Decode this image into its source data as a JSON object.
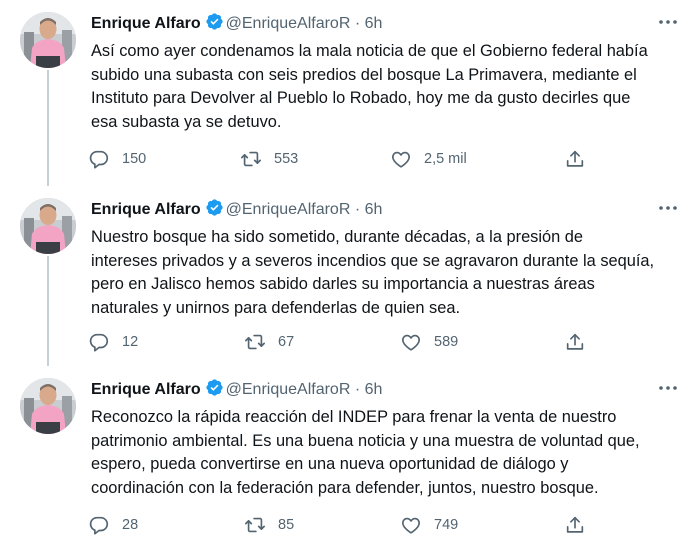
{
  "tweets": [
    {
      "name": "Enrique Alfaro",
      "handle": "@EnriqueAlfaroR",
      "time": "· 6h",
      "lines": [
        "Así como ayer condenamos la mala noticia de que el Gobierno federal había",
        "subido una subasta con seis predios del bosque La Primavera, mediante el",
        "Instituto para Devolver al Pueblo lo Robado, hoy me da gusto decirles que",
        "esa subasta ya se detuvo."
      ],
      "replies": "150",
      "retweets": "553",
      "likes": "2,5 mil"
    },
    {
      "name": "Enrique Alfaro",
      "handle": "@EnriqueAlfaroR",
      "time": "· 6h",
      "lines": [
        "Nuestro bosque ha sido sometido, durante décadas, a la presión de",
        "intereses privados y a severos incendios que se agravaron durante la sequía,",
        "pero en Jalisco hemos sabido darles su importancia a nuestras áreas",
        "naturales y unirnos para defenderlas de quien sea."
      ],
      "replies": "12",
      "retweets": "67",
      "likes": "589"
    },
    {
      "name": "Enrique Alfaro",
      "handle": "@EnriqueAlfaroR",
      "time": "· 6h",
      "lines": [
        "Reconozco la rápida reacción del INDEP para frenar la venta de nuestro",
        "patrimonio ambiental. Es una buena noticia y una muestra de voluntad que,",
        "espero, pueda convertirse en una nueva oportunidad de diálogo y",
        "coordinación con la federación para defender, juntos, nuestro bosque."
      ],
      "replies": "28",
      "retweets": "85",
      "likes": "749"
    }
  ],
  "icons": {
    "verified": "verified-badge-icon",
    "more": "more-icon",
    "reply": "reply-icon",
    "retweet": "retweet-icon",
    "like": "like-icon",
    "share": "share-icon"
  },
  "colors": {
    "text": "#0f1419",
    "secondary": "#536471",
    "verified": "#1d9bf0",
    "thread_line": "#c4cfd6"
  }
}
